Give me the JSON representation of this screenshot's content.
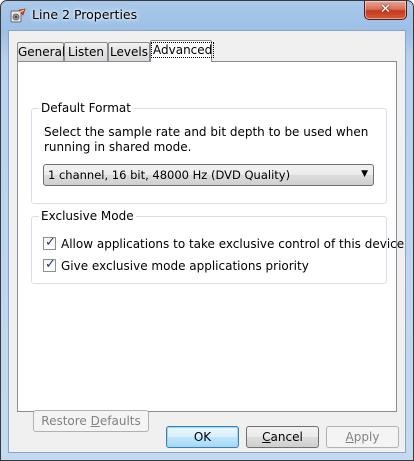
{
  "window": {
    "title": "Line 2 Properties",
    "icon": "speaker-properties-icon",
    "close_glyph": "✕"
  },
  "tabs": [
    {
      "label": "General",
      "active": false
    },
    {
      "label": "Listen",
      "active": false
    },
    {
      "label": "Levels",
      "active": false
    },
    {
      "label": "Advanced",
      "active": true
    }
  ],
  "default_format": {
    "legend": "Default Format",
    "description": "Select the sample rate and bit depth to be used when running in shared mode.",
    "selected": "1 channel, 16 bit, 48000 Hz (DVD Quality)",
    "arrow": "▼"
  },
  "exclusive_mode": {
    "legend": "Exclusive Mode",
    "options": [
      {
        "label": "Allow applications to take exclusive control of this device",
        "checked": true
      },
      {
        "label": "Give exclusive mode applications priority",
        "checked": true
      }
    ],
    "check_glyph": "✓"
  },
  "buttons": {
    "restore_pre": "Restore ",
    "restore_key": "D",
    "restore_post": "efaults",
    "ok": "OK",
    "cancel_pre": "",
    "cancel_key": "C",
    "cancel_post": "ancel",
    "apply_pre": "",
    "apply_key": "A",
    "apply_post": "pply"
  },
  "colors": {
    "title_bar": "#a9c8ea",
    "close_button": "#c4391f",
    "checkmark": "#21386e",
    "default_button_border": "#3c7fb1"
  }
}
